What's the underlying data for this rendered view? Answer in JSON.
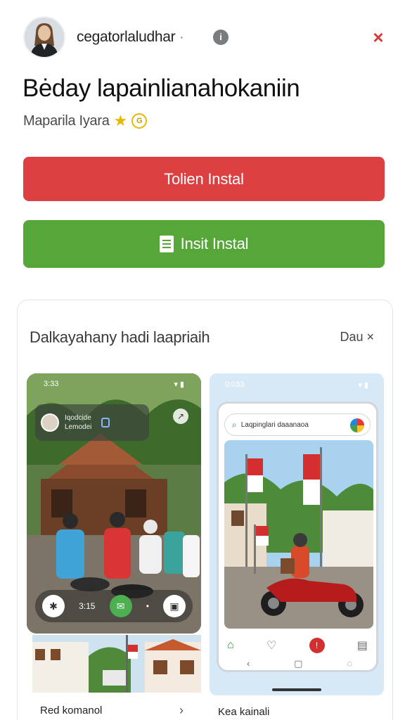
{
  "header": {
    "developer_name": "cegatorla",
    "developer_suffix": "ludhar",
    "separator": "·",
    "info_icon": "info-icon",
    "close_icon": "close-icon",
    "close_glyph": "×",
    "info_glyph": "i"
  },
  "app": {
    "title": "Bėday lapainlianahokaniin",
    "subtitle": "Maparila Iyara",
    "star_glyph": "★",
    "badge_glyph": "G"
  },
  "buttons": {
    "primary_label": "Tolien Instal",
    "secondary_label": "Insit Instal"
  },
  "card": {
    "title": "Dalkayahany hadi laapriaih",
    "action": "Dau ×"
  },
  "screenshots": {
    "left": {
      "time": "3:33",
      "status_icons": "▾ ▮",
      "chip_line1": "Iqodcide",
      "chip_line2": "Lemodei",
      "bar_time": "3:15",
      "caption": "Red komanol",
      "chevron": "›"
    },
    "right": {
      "time": "0:033",
      "status_icons": "▾ ▮",
      "search_text": "Laqpinglari daaanaoa",
      "caption": "Kea kainali"
    }
  },
  "colors": {
    "red_button": "#dc4040",
    "green_button": "#56a63a",
    "close_red": "#d83a3a",
    "star_yellow": "#e6b800"
  }
}
